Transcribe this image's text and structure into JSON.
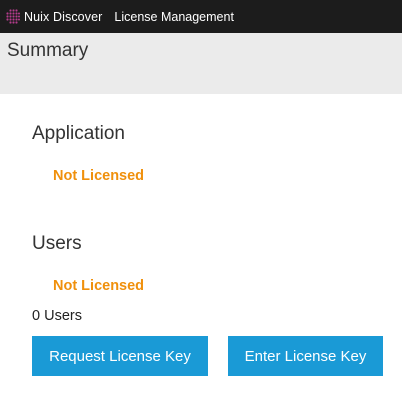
{
  "header": {
    "brand": "Nuix Discover",
    "page_name": "License Management",
    "logo_icon": "nuix-dot-grid-icon",
    "logo_color": "#b43c8c",
    "background": "#1c1c1c"
  },
  "summary": {
    "title": "Summary",
    "background": "#ebebeb"
  },
  "application": {
    "heading": "Application",
    "status": "Not Licensed"
  },
  "users": {
    "heading": "Users",
    "status": "Not Licensed",
    "count_text": "0 Users"
  },
  "actions": {
    "request_label": "Request License Key",
    "enter_label": "Enter License Key",
    "button_color": "#1a9ad6"
  },
  "colors": {
    "status_warning": "#f0900c"
  }
}
